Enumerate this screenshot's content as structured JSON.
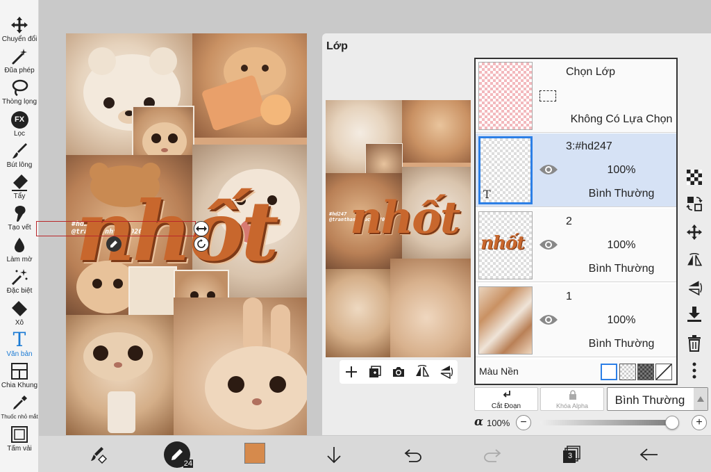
{
  "toolbar": {
    "tools": [
      {
        "label": "Chuyển đổi",
        "icon": "move-arrows-icon"
      },
      {
        "label": "Đũa phép",
        "icon": "magic-wand-icon"
      },
      {
        "label": "Thòng lọng",
        "icon": "lasso-icon"
      },
      {
        "label": "Lọc",
        "icon": "fx-filter-icon",
        "icon_text": "FX"
      },
      {
        "label": "Bút lông",
        "icon": "brush-icon"
      },
      {
        "label": "Tẩy",
        "icon": "eraser-icon"
      },
      {
        "label": "Tạo vết",
        "icon": "smudge-icon"
      },
      {
        "label": "Làm mờ",
        "icon": "blur-drop-icon"
      },
      {
        "label": "Đặc biệt",
        "icon": "special-sparkle-icon"
      },
      {
        "label": "Xô",
        "icon": "bucket-icon"
      },
      {
        "label": "Văn bản",
        "icon": "text-tool-icon",
        "icon_text": "T",
        "active": true
      },
      {
        "label": "Chia Khung",
        "icon": "frame-divider-icon"
      },
      {
        "label": "Thuốc nhỏ mắt",
        "icon": "eyedropper-icon"
      },
      {
        "label": "Tấm vải",
        "icon": "canvas-icon"
      }
    ]
  },
  "canvas": {
    "artwork_text": {
      "tag_line": "#hd247",
      "credit_line": "@tranthanhtruc020709",
      "headline": "nhốt"
    }
  },
  "layer_panel": {
    "title": "Lớp",
    "selection_row": {
      "title": "Chọn Lớp",
      "status": "Không Có Lựa Chọn"
    },
    "layers": [
      {
        "name": "3:#hd247",
        "opacity": "100%",
        "blend": "Bình Thường",
        "selected": true,
        "thumb_glyph": "T"
      },
      {
        "name": "2",
        "opacity": "100%",
        "blend": "Bình Thường",
        "selected": false
      },
      {
        "name": "1",
        "opacity": "100%",
        "blend": "Bình Thường",
        "selected": false
      }
    ],
    "background_label": "Màu Nền",
    "clip_label": "Cắt Đoạn",
    "alpha_lock_label": "Khóa Alpha",
    "blend_mode_value": "Bình Thường",
    "alpha_symbol": "α",
    "alpha_value": "100%",
    "alpha_fraction": 1.0,
    "minus": "−",
    "plus": "+"
  },
  "bottom_bar": {
    "brush_size": "24",
    "color": "#d68a4c",
    "layer_count": "3"
  },
  "colors": {
    "accent_blue": "#2c7fe6",
    "headline_orange": "#c8672d",
    "selection_red": "#b9262a"
  }
}
